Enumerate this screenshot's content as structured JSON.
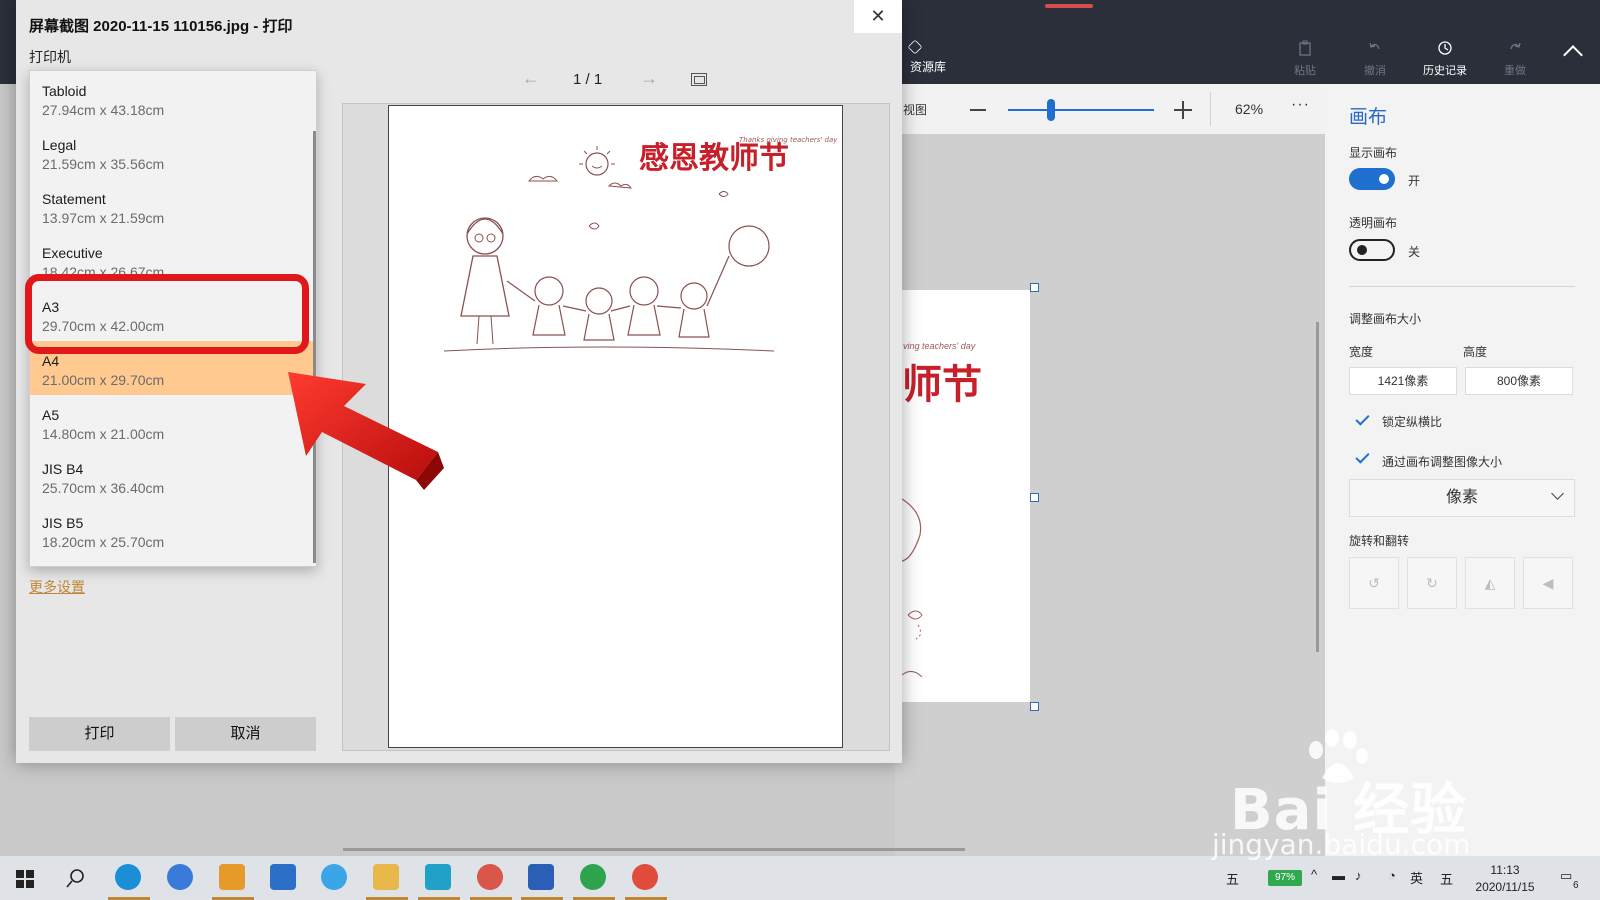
{
  "dialog": {
    "title": "屏幕截图 2020-11-15 110156.jpg - 打印",
    "close_glyph": "✕",
    "printer_label": "打印机",
    "more_settings": "更多设置",
    "print_button": "打印",
    "cancel_button": "取消",
    "page_indicator": "1 / 1",
    "prev_glyph": "←",
    "next_glyph": "→"
  },
  "paper_sizes": [
    {
      "name": "Tabloid",
      "size": "27.94cm x 43.18cm"
    },
    {
      "name": "Legal",
      "size": "21.59cm x 35.56cm"
    },
    {
      "name": "Statement",
      "size": "13.97cm x 21.59cm"
    },
    {
      "name": "Executive",
      "size": "18.42cm x 26.67cm"
    },
    {
      "name": "A3",
      "size": "29.70cm x 42.00cm"
    },
    {
      "name": "A4",
      "size": "21.00cm x 29.70cm"
    },
    {
      "name": "A5",
      "size": "14.80cm x 21.00cm"
    },
    {
      "name": "JIS B4",
      "size": "25.70cm x 36.40cm"
    },
    {
      "name": "JIS B5",
      "size": "18.20cm x 25.70cm"
    }
  ],
  "selected_paper": "A4",
  "highlighted_paper": "A3",
  "preview": {
    "title_text": "感恩教师节",
    "subtitle_text": "Thanks giving teachers' day"
  },
  "paint_app": {
    "toolbar": [
      {
        "label": "资源库",
        "icon": "library-icon"
      },
      {
        "label": "粘贴",
        "icon": "paste-icon"
      },
      {
        "label": "撤消",
        "icon": "undo-icon"
      },
      {
        "label": "历史记录",
        "icon": "history-icon"
      },
      {
        "label": "重做",
        "icon": "redo-icon"
      }
    ],
    "view_label": "视图",
    "zoom_percent": "62%",
    "zoom_level": 0.27,
    "more_glyph": "···",
    "canvas_preview_text": "师节",
    "canvas_preview_small": "ving teachers' day"
  },
  "canvas_panel": {
    "title": "画布",
    "show_canvas_label": "显示画布",
    "show_canvas_state": "开",
    "transparent_label": "透明画布",
    "transparent_state": "关",
    "resize_label": "调整画布大小",
    "width_label": "宽度",
    "height_label": "高度",
    "width_value": "1421像素",
    "height_value": "800像素",
    "lock_ratio_label": "锁定纵横比",
    "resize_image_label": "通过画布调整图像大小",
    "unit_value": "像素",
    "rotate_label": "旋转和翻转"
  },
  "taskbar": {
    "battery": "97%",
    "ime_mode": "五",
    "lang": "英",
    "ime_mode2": "五",
    "time": "11:13",
    "date": "2020/11/15",
    "notif_count": "6"
  },
  "watermark": {
    "big": "Bai  经验",
    "small": "jingyan.baidu.com"
  },
  "colors": {
    "accent_blue": "#1f6fd1",
    "selected_orange": "#ffc98f",
    "highlight_red": "#e0171b",
    "title_red": "#c7202a"
  }
}
